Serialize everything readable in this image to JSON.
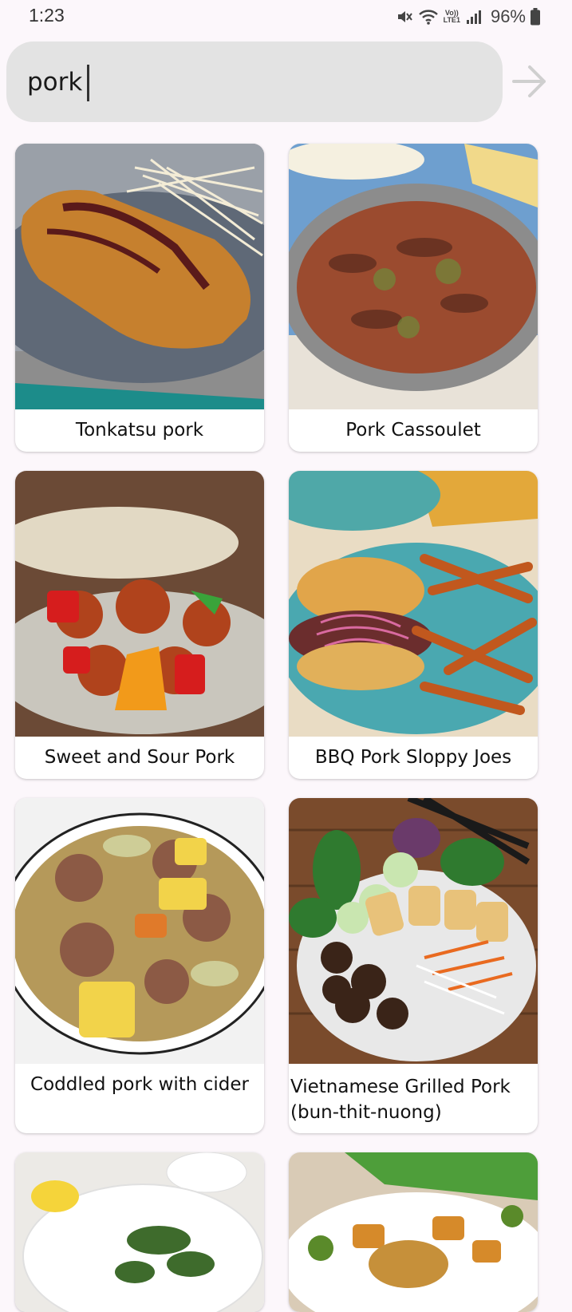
{
  "status_bar": {
    "time": "1:23",
    "battery": "96%",
    "icons": [
      "mute-icon",
      "wifi-icon",
      "volte-icon",
      "signal-icon",
      "battery-icon"
    ],
    "volte_line1": "Vo))",
    "volte_line2": "LTE1"
  },
  "search": {
    "value": "pork",
    "submit_icon": "arrow-right-icon"
  },
  "recipes": [
    {
      "title": "Tonkatsu pork"
    },
    {
      "title": "Pork Cassoulet"
    },
    {
      "title": "Sweet and Sour Pork"
    },
    {
      "title": "BBQ Pork Sloppy Joes"
    },
    {
      "title": "Coddled pork with cider"
    },
    {
      "title": "Vietnamese Grilled Pork (bun-thit-nuong)"
    },
    {
      "title": ""
    },
    {
      "title": ""
    }
  ],
  "colors": {
    "background": "#fcf7fb",
    "search_bg": "#e3e3e3",
    "arrow": "#cfcfcf"
  }
}
